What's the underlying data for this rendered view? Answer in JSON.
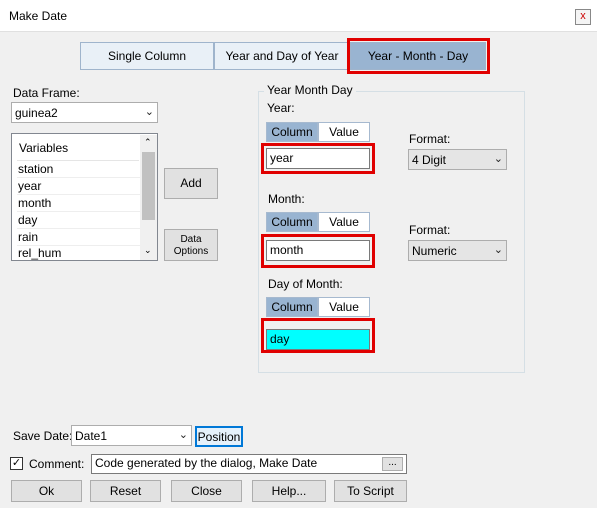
{
  "window": {
    "title": "Make Date",
    "close": "x"
  },
  "modes": [
    "Single Column",
    "Year and Day of Year",
    "Year - Month - Day"
  ],
  "data_frame": {
    "label": "Data Frame:",
    "value": "guinea2"
  },
  "variables": {
    "header": "Variables",
    "items": [
      "station",
      "year",
      "month",
      "day",
      "rain",
      "rel_hum"
    ]
  },
  "buttons": {
    "add": "Add",
    "data_options_1": "Data",
    "data_options_2": "Options"
  },
  "ymd_group": {
    "title": "Year Month Day",
    "year": {
      "label": "Year:",
      "column": "Column",
      "value_tab": "Value",
      "receiver": "year"
    },
    "month": {
      "label": "Month:",
      "column": "Column",
      "value_tab": "Value",
      "receiver": "month"
    },
    "day": {
      "label": "Day of Month:",
      "column": "Column",
      "value_tab": "Value",
      "receiver": "day"
    },
    "year_format": {
      "label": "Format:",
      "value": "4 Digit"
    },
    "month_format": {
      "label": "Format:",
      "value": "Numeric"
    }
  },
  "save": {
    "label": "Save Date:",
    "value": "Date1",
    "position": "Position"
  },
  "comment": {
    "label": "Comment:",
    "value": "Code generated by the dialog, Make Date",
    "browse": "...",
    "checked": "✓"
  },
  "bottom_buttons": [
    "Ok",
    "Reset",
    "Close",
    "Help...",
    "To Script"
  ],
  "colors": {
    "highlight": "#e00000",
    "selected_receiver": "#00ffff",
    "active_tab": "#99b4d1"
  }
}
